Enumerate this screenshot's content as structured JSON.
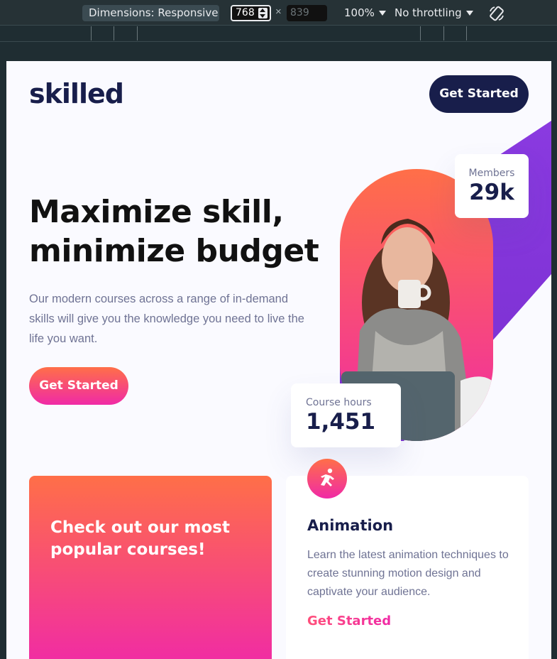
{
  "devtools": {
    "dimensions_label": "Dimensions: Responsive",
    "width_value": "768",
    "times": "×",
    "height_placeholder": "839",
    "zoom_label": "100%",
    "throttle_label": "No throttling",
    "rotate_icon": "rotate-icon"
  },
  "site": {
    "logo": "skilled",
    "header_cta": "Get Started"
  },
  "hero": {
    "title_line1": "Maximize skill,",
    "title_line2": "minimize budget",
    "body": "Our modern courses across a range of in-demand skills will give you the knowledge you need to live the life you want.",
    "cta": "Get Started"
  },
  "stats": {
    "members_label": "Members",
    "members_value": "29k",
    "hours_label": "Course hours",
    "hours_value": "1,451"
  },
  "promo": {
    "title": "Check out our most popular courses!"
  },
  "course": {
    "icon": "running-figure-icon",
    "title": "Animation",
    "body": "Learn the latest animation techniques to create stunning motion design and captivate your audience.",
    "link": "Get Started"
  },
  "colors": {
    "navy": "#181e4b",
    "gradient_top": "#ff6f48",
    "gradient_bottom": "#f02aa6",
    "purple": "#8a3ae0",
    "muted_text": "#6f7394"
  }
}
